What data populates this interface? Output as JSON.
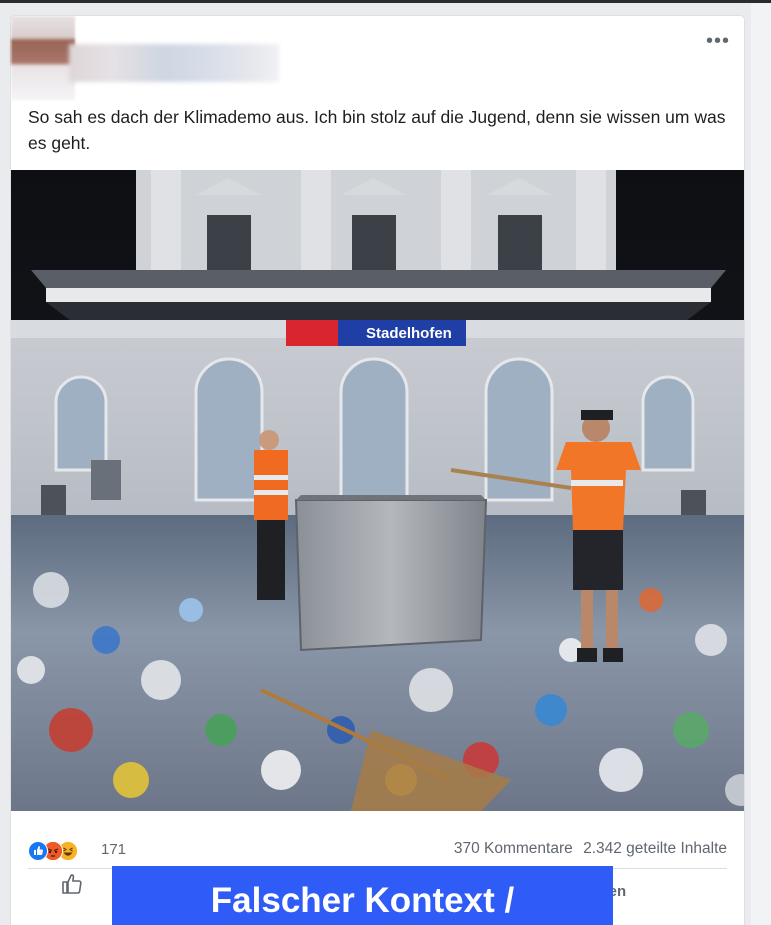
{
  "post": {
    "text": "So sah es dach der Klimademo aus. Ich bin stolz auf die Jugend, denn sie wissen um was es geht.",
    "image": {
      "station_sign": "Stadelhofen"
    }
  },
  "engagement": {
    "reactions": [
      "like-icon",
      "angry-icon",
      "haha-icon"
    ],
    "reaction_count": "171",
    "comments": "370 Kommentare",
    "shares": "2.342 geteilte Inhalte"
  },
  "actions": {
    "share_label": "eilen"
  },
  "overlay": {
    "label": "Falscher Kontext /",
    "color": "#2f5bf6"
  },
  "colors": {
    "facebook_blue": "#1877f2",
    "text_gray": "#606770"
  }
}
